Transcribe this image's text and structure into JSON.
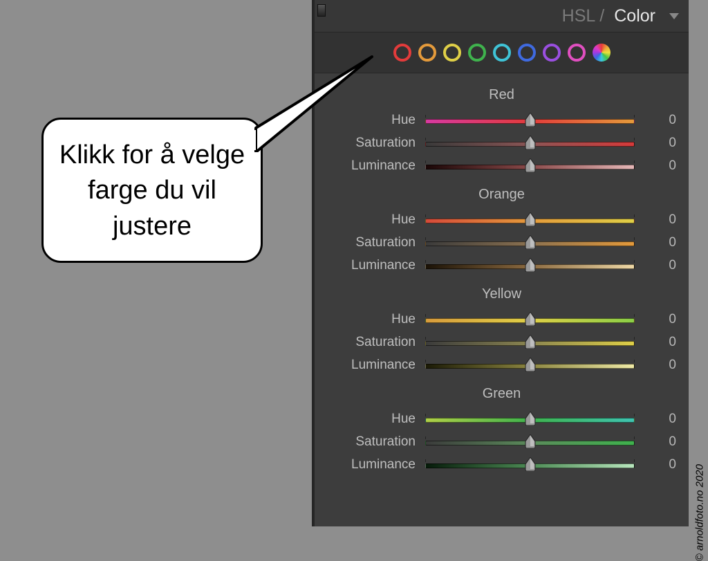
{
  "panel": {
    "title_hsl": "HSL /",
    "title_color": "Color"
  },
  "swatches": [
    {
      "name": "red",
      "color": "#e23b3b"
    },
    {
      "name": "orange",
      "color": "#e49a3b"
    },
    {
      "name": "yellow",
      "color": "#dfcf47"
    },
    {
      "name": "green",
      "color": "#3fb24d"
    },
    {
      "name": "aqua",
      "color": "#3fc3d6"
    },
    {
      "name": "blue",
      "color": "#3f6ae0"
    },
    {
      "name": "purple",
      "color": "#9a4fe0"
    },
    {
      "name": "magenta",
      "color": "#e04fc0"
    }
  ],
  "groups": [
    {
      "name": "Red",
      "sliders": [
        {
          "label": "Hue",
          "value": 0,
          "gradient": [
            "#d63aa1",
            "#e23b3b",
            "#e49a3b"
          ]
        },
        {
          "label": "Saturation",
          "value": 0,
          "gradient": [
            "#3a3a3a",
            "#8a5555",
            "#d63a3a"
          ]
        },
        {
          "label": "Luminance",
          "value": 0,
          "gradient": [
            "#1a0606",
            "#8a4a4a",
            "#e6b8b8"
          ]
        }
      ]
    },
    {
      "name": "Orange",
      "sliders": [
        {
          "label": "Hue",
          "value": 0,
          "gradient": [
            "#d64a3a",
            "#e49a3b",
            "#dfcf47"
          ]
        },
        {
          "label": "Saturation",
          "value": 0,
          "gradient": [
            "#3b3b3b",
            "#8b7150",
            "#e49a3b"
          ]
        },
        {
          "label": "Luminance",
          "value": 0,
          "gradient": [
            "#1b1206",
            "#8b6a40",
            "#eed8a6"
          ]
        }
      ]
    },
    {
      "name": "Yellow",
      "sliders": [
        {
          "label": "Hue",
          "value": 0,
          "gradient": [
            "#d79b3c",
            "#dfcf47",
            "#8bcf47"
          ]
        },
        {
          "label": "Saturation",
          "value": 0,
          "gradient": [
            "#3b3b3b",
            "#8b8550",
            "#dfcf47"
          ]
        },
        {
          "label": "Luminance",
          "value": 0,
          "gradient": [
            "#1b1a06",
            "#8b8540",
            "#efeaa6"
          ]
        }
      ]
    },
    {
      "name": "Green",
      "sliders": [
        {
          "label": "Hue",
          "value": 0,
          "gradient": [
            "#b0cf47",
            "#3fb24d",
            "#3fc3b0"
          ]
        },
        {
          "label": "Saturation",
          "value": 0,
          "gradient": [
            "#3b3b3b",
            "#5b8b5b",
            "#3fb24d"
          ]
        },
        {
          "label": "Luminance",
          "value": 0,
          "gradient": [
            "#061b0a",
            "#4d8b55",
            "#b8e6bd"
          ]
        }
      ]
    }
  ],
  "callout": {
    "text": "Klikk for å velge farge du vil justere"
  },
  "copyright": "© arnoldfoto.no 2020"
}
